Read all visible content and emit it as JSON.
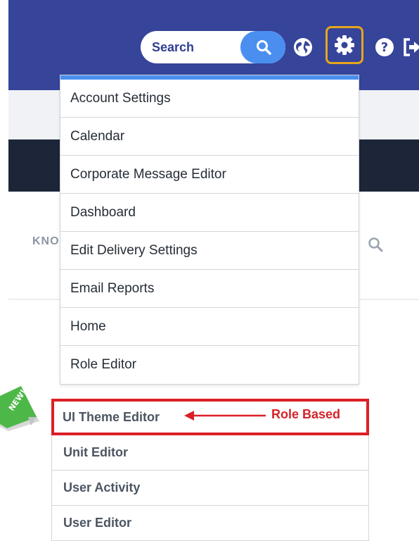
{
  "header": {
    "search_label": "Search",
    "icons": [
      "search-icon",
      "globe-icon",
      "gear-icon",
      "help-icon",
      "logout-icon"
    ]
  },
  "page": {
    "nav_partial_text": "KNO",
    "nav_search_icon": "search-icon"
  },
  "settings_menu": {
    "items": [
      {
        "label": "Account Settings"
      },
      {
        "label": "Calendar"
      },
      {
        "label": "Corporate Message Editor"
      },
      {
        "label": "Dashboard"
      },
      {
        "label": "Edit Delivery Settings"
      },
      {
        "label": "Email Reports"
      },
      {
        "label": "Home"
      },
      {
        "label": "Role Editor"
      }
    ]
  },
  "extended_menu": {
    "items": [
      {
        "label": "UI Theme Editor"
      },
      {
        "label": "Unit Editor"
      },
      {
        "label": "User Activity"
      },
      {
        "label": "User Editor"
      }
    ],
    "annotation": "Role Based",
    "badge_text": "NEW!"
  },
  "colors": {
    "header_bg": "#36449a",
    "search_button": "#4a8ff0",
    "gear_highlight": "#e7a51c",
    "annotation_red": "#dc1f26",
    "badge_green": "#4db848"
  }
}
